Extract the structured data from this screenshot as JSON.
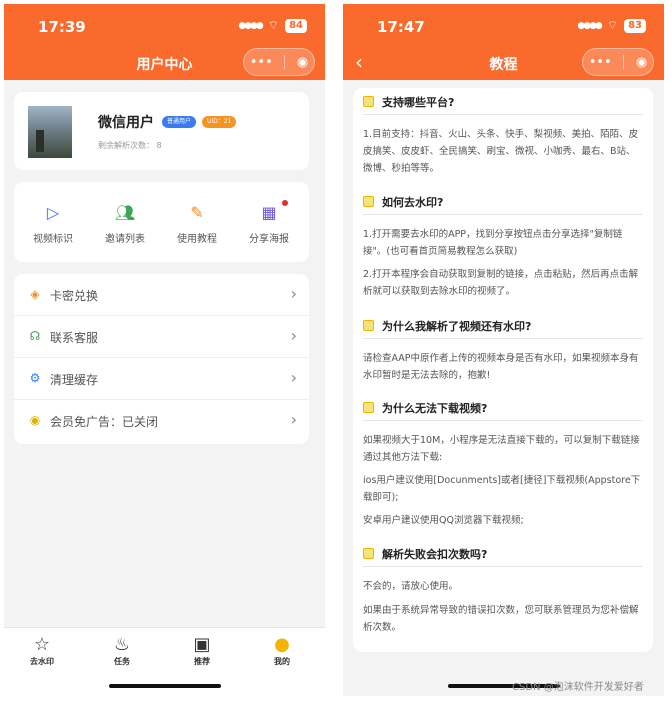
{
  "left": {
    "status": {
      "time": "17:39",
      "battery": "84"
    },
    "nav_title": "用户中心",
    "profile": {
      "name": "微信用户",
      "badge_user": "普通用户",
      "badge_uid": "UID：21",
      "remaining": "剩余解析次数： 8"
    },
    "quick": [
      {
        "label": "视频标识",
        "icon": "play-circle-icon"
      },
      {
        "label": "邀请列表",
        "icon": "users-icon"
      },
      {
        "label": "使用教程",
        "icon": "edit-icon"
      },
      {
        "label": "分享海报",
        "icon": "qrcode-icon"
      }
    ],
    "menu": [
      {
        "label": "卡密兑换",
        "icon": "ticket-icon"
      },
      {
        "label": "联系客服",
        "icon": "headset-icon"
      },
      {
        "label": "清理缓存",
        "icon": "gear-icon"
      },
      {
        "label": "会员免广告：已关闭",
        "icon": "vip-icon"
      }
    ],
    "tabs": [
      {
        "label": "去水印",
        "icon": "star-icon"
      },
      {
        "label": "任务",
        "icon": "flame-icon"
      },
      {
        "label": "推荐",
        "icon": "apps-icon"
      },
      {
        "label": "我的",
        "icon": "user-icon"
      }
    ]
  },
  "right": {
    "status": {
      "time": "17:47",
      "battery": "83"
    },
    "nav_title": "教程",
    "faq": [
      {
        "q": "支持哪些平台?",
        "a": [
          "1.目前支持：抖音、火山、头条、快手、梨视频、美拍、陌陌、皮皮搞笑、皮皮虾、全民搞笑、刷宝、微视、小咖秀、最右、B站、微博、秒拍等等。"
        ]
      },
      {
        "q": "如何去水印?",
        "a": [
          "1.打开需要去水印的APP，找到分享按钮点击分享选择\"复制链接\"。(也可看首页简易教程怎么获取)",
          "2.打开本程序会自动获取到复制的链接，点击粘贴，然后再点击解析就可以获取到去除水印的视频了。"
        ]
      },
      {
        "q": "为什么我解析了视频还有水印?",
        "a": [
          "请检查AAP中原作者上传的视频本身是否有水印，如果视频本身有水印暂时是无法去除的，抱歉!"
        ]
      },
      {
        "q": "为什么无法下载视频?",
        "a": [
          "如果视频大于10M，小程序是无法直接下载的，可以复制下载链接通过其他方法下载:",
          "ios用户建议使用[Docunments]或者[捷径]下载视频(Appstore下载即可);",
          "安卓用户建议使用QQ浏览器下载视频;"
        ]
      },
      {
        "q": "解析失败会扣次数吗?",
        "a": [
          "不会的，请放心使用。",
          "如果由于系统异常导致的错误扣次数，您可联系管理员为您补偿解析次数。"
        ]
      }
    ]
  },
  "watermark": "CSDN @泡沫软件开发爱好者",
  "colors": {
    "brand": "#fa6a2c",
    "blue": "#2f7cf6",
    "green": "#3aa657",
    "orange": "#f08a24"
  }
}
